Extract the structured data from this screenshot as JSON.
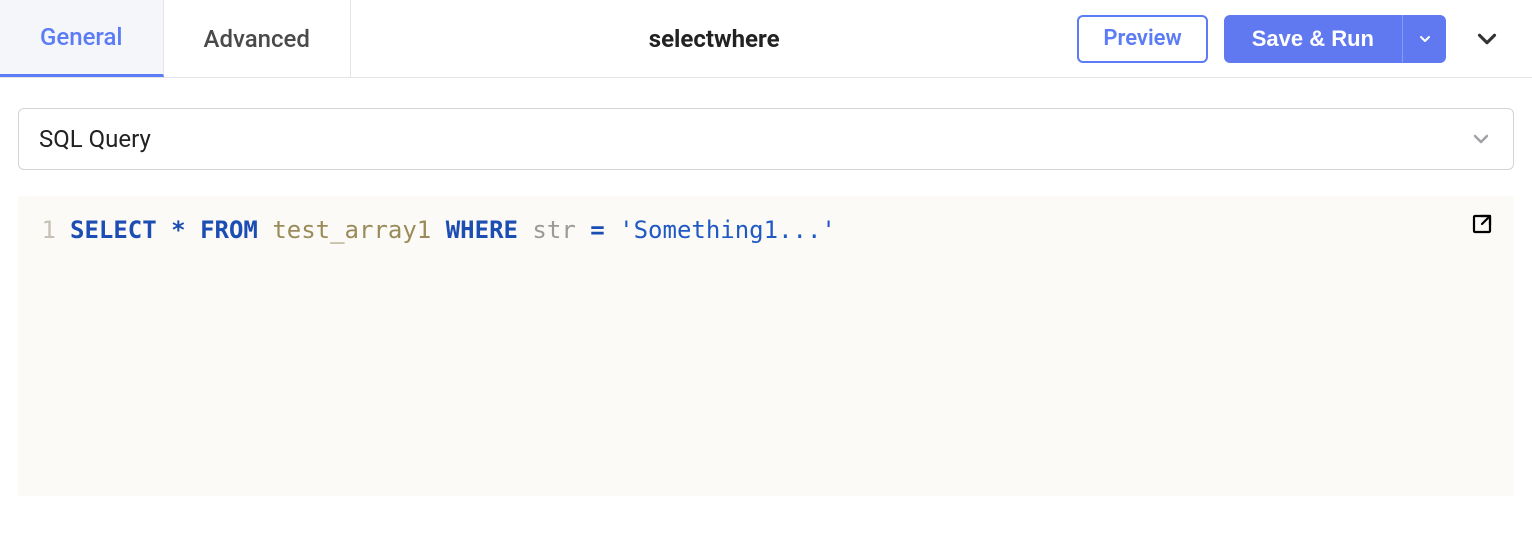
{
  "tabs": {
    "general": "General",
    "advanced": "Advanced"
  },
  "title": "selectwhere",
  "buttons": {
    "preview": "Preview",
    "save_run": "Save & Run"
  },
  "section": {
    "label": "SQL Query"
  },
  "editor": {
    "line_number": "1",
    "tokens": {
      "select": "SELECT",
      "star": "*",
      "from": "FROM",
      "table": "test_array1",
      "where": "WHERE",
      "col": "str",
      "eq": "=",
      "string": "'Something1...'"
    }
  }
}
